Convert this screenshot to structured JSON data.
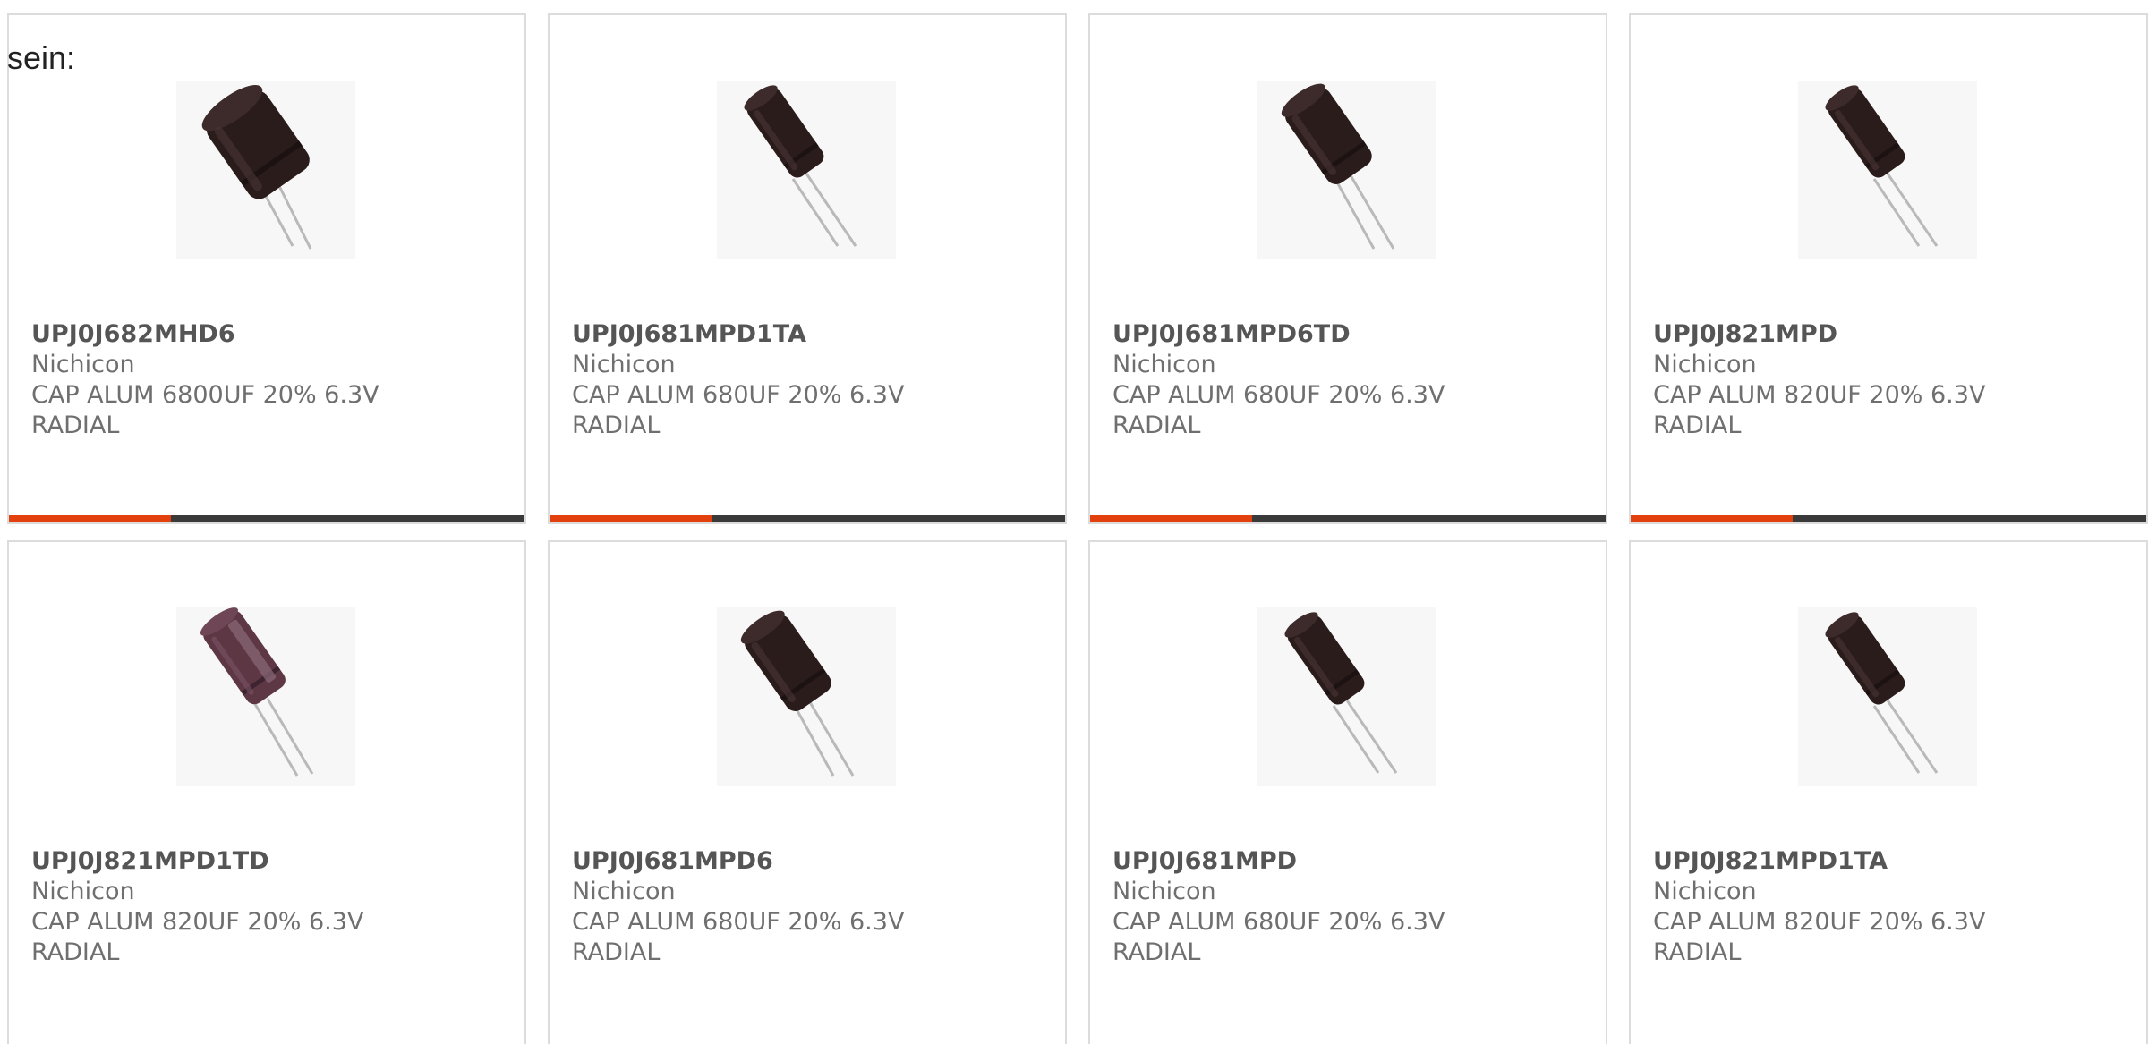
{
  "intro": "sein:",
  "colors": {
    "accent": "#e2400d",
    "bar_track": "#3a3a3a",
    "card_border": "#dcdcdc",
    "capacitor_dark": "#2b1c1c",
    "capacitor_plum": "#5e3744"
  },
  "products": [
    {
      "part_number": "UPJ0J682MHD6",
      "manufacturer": "Nichicon",
      "desc_line1": "CAP ALUM 6800UF 20% 6.3V",
      "desc_line2": "RADIAL",
      "image": "capacitor-large-icon",
      "bar_fill": 0.315
    },
    {
      "part_number": "UPJ0J681MPD1TA",
      "manufacturer": "Nichicon",
      "desc_line1": "CAP ALUM 680UF 20% 6.3V",
      "desc_line2": "RADIAL",
      "image": "capacitor-slim-icon",
      "bar_fill": 0.315
    },
    {
      "part_number": "UPJ0J681MPD6TD",
      "manufacturer": "Nichicon",
      "desc_line1": "CAP ALUM 680UF 20% 6.3V",
      "desc_line2": "RADIAL",
      "image": "capacitor-medium-icon",
      "bar_fill": 0.315
    },
    {
      "part_number": "UPJ0J821MPD",
      "manufacturer": "Nichicon",
      "desc_line1": "CAP ALUM 820UF 20% 6.3V",
      "desc_line2": "RADIAL",
      "image": "capacitor-slim-icon",
      "bar_fill": 0.315
    },
    {
      "part_number": "UPJ0J821MPD1TD",
      "manufacturer": "Nichicon",
      "desc_line1": "CAP ALUM 820UF 20% 6.3V",
      "desc_line2": "RADIAL",
      "image": "capacitor-plum-icon"
    },
    {
      "part_number": "UPJ0J681MPD6",
      "manufacturer": "Nichicon",
      "desc_line1": "CAP ALUM 680UF 20% 6.3V",
      "desc_line2": "RADIAL",
      "image": "capacitor-medium-icon"
    },
    {
      "part_number": "UPJ0J681MPD",
      "manufacturer": "Nichicon",
      "desc_line1": "CAP ALUM 680UF 20% 6.3V",
      "desc_line2": "RADIAL",
      "image": "capacitor-slim-icon"
    },
    {
      "part_number": "UPJ0J821MPD1TA",
      "manufacturer": "Nichicon",
      "desc_line1": "CAP ALUM 820UF 20% 6.3V",
      "desc_line2": "RADIAL",
      "image": "capacitor-slim-icon"
    }
  ]
}
